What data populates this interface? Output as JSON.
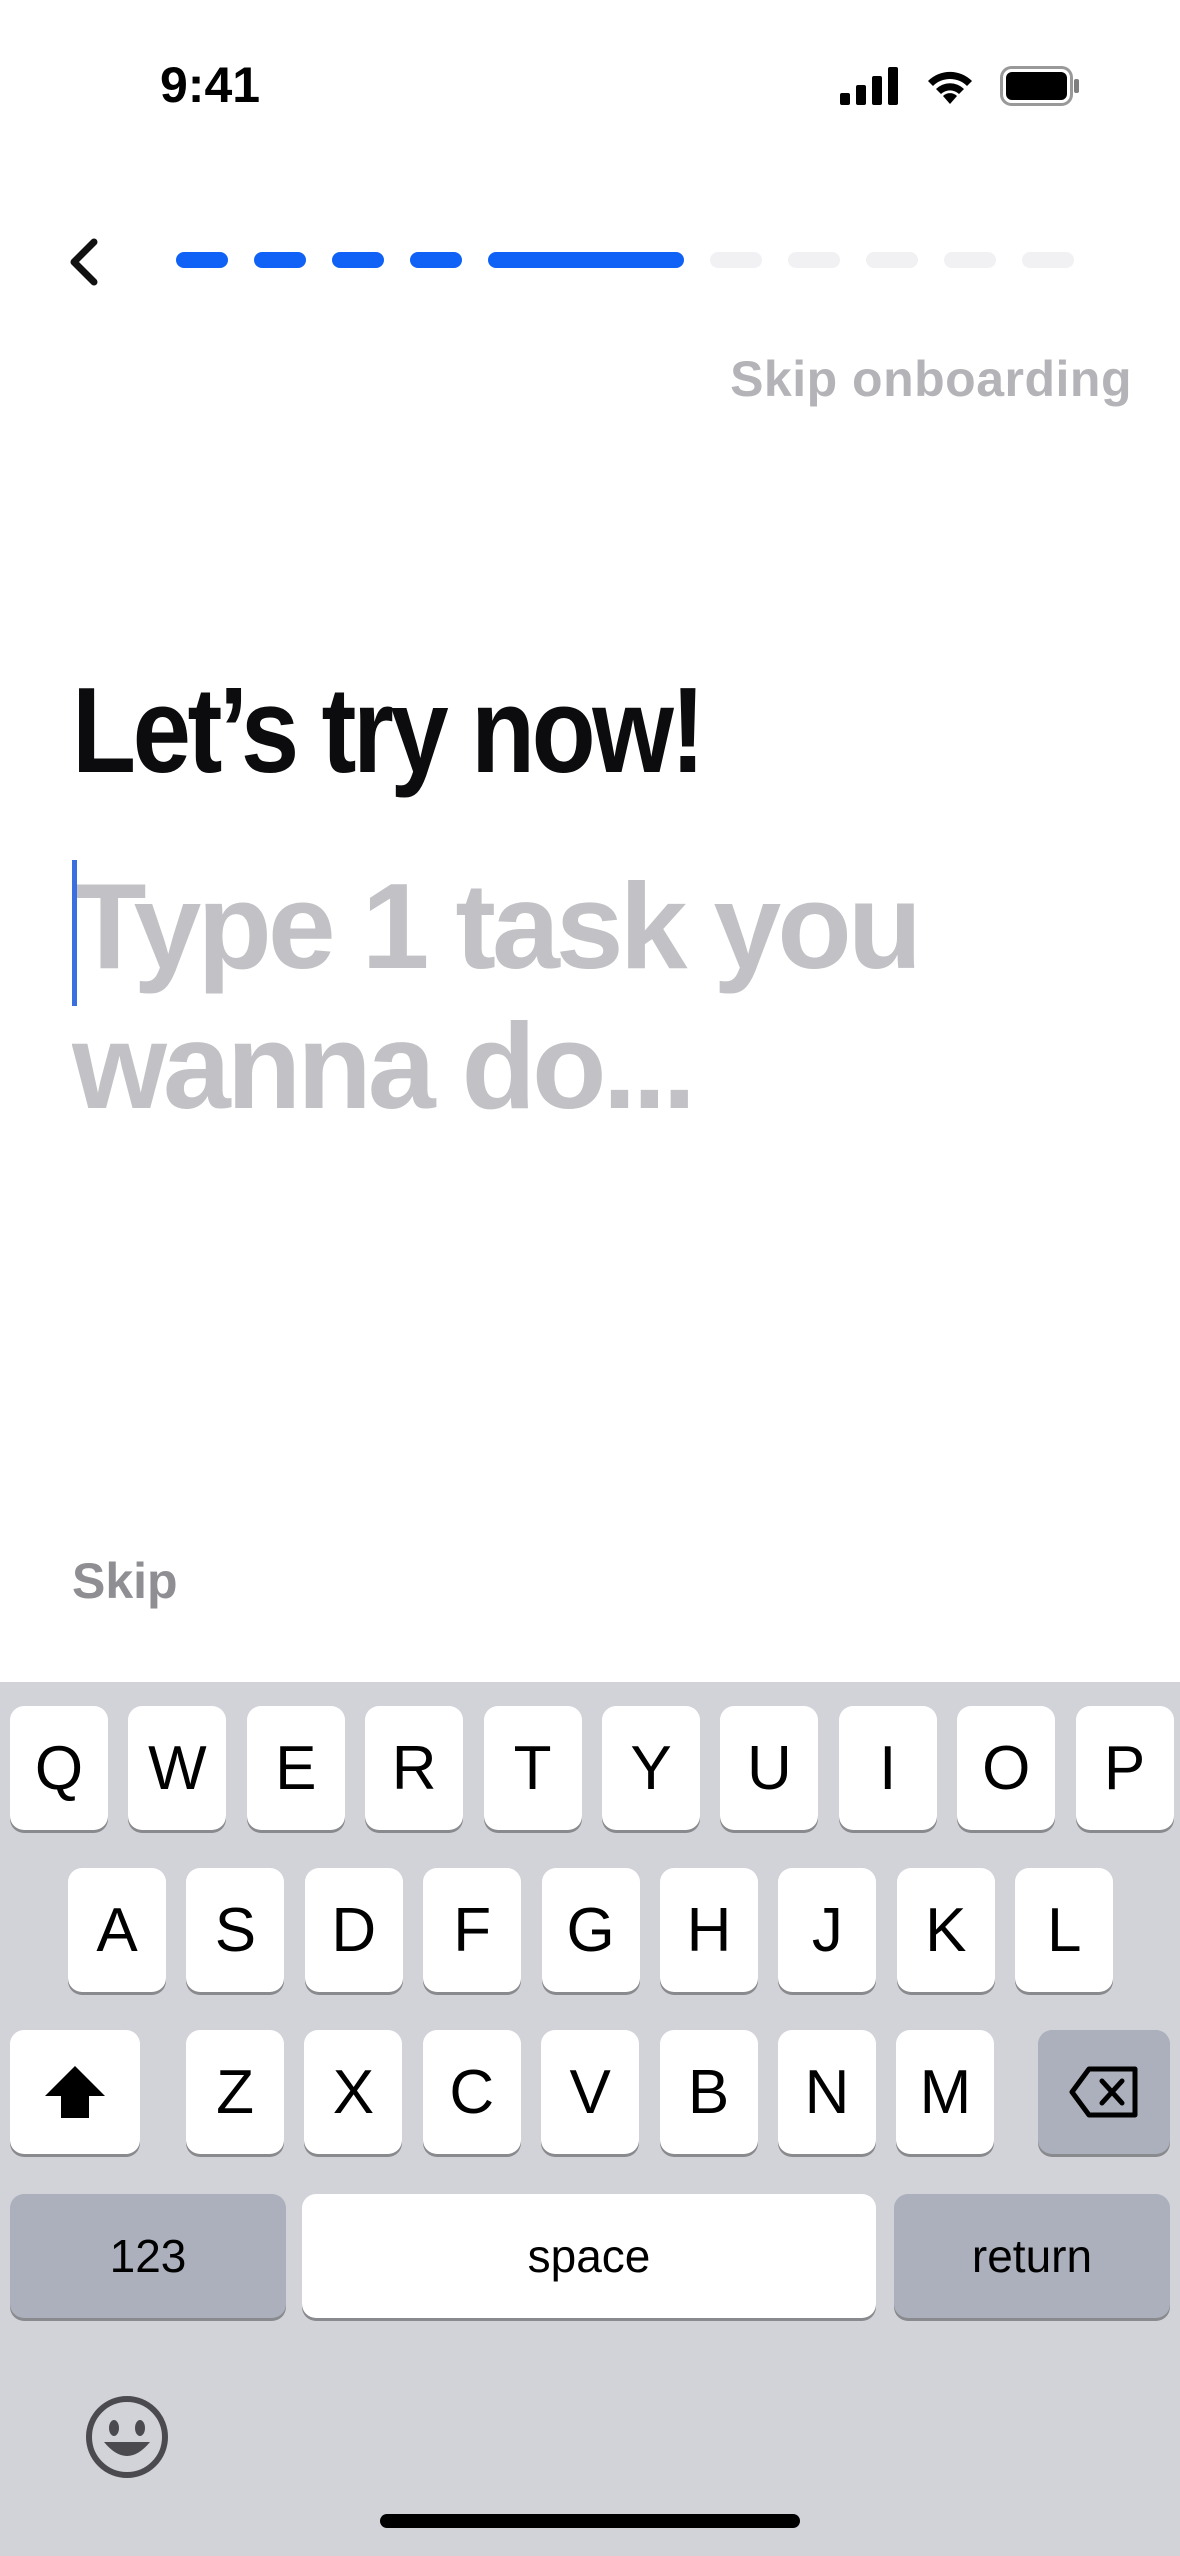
{
  "status_bar": {
    "time": "9:41"
  },
  "header": {
    "back_icon": "chevron-left-icon",
    "progress": {
      "total_steps": 10,
      "current_step": 5,
      "completed_steps": 4
    },
    "skip_onboarding_label": "Skip onboarding"
  },
  "content": {
    "heading": "Let’s try now!",
    "task_input": {
      "value": "",
      "placeholder": "Type 1 task you wanna do..."
    },
    "skip_label": "Skip"
  },
  "keyboard": {
    "row1": [
      "Q",
      "W",
      "E",
      "R",
      "T",
      "Y",
      "U",
      "I",
      "O",
      "P"
    ],
    "row2": [
      "A",
      "S",
      "D",
      "F",
      "G",
      "H",
      "J",
      "K",
      "L"
    ],
    "row3": [
      "Z",
      "X",
      "C",
      "V",
      "B",
      "N",
      "M"
    ],
    "numbers_label": "123",
    "space_label": "space",
    "return_label": "return",
    "shift_icon": "shift-icon",
    "delete_icon": "delete-icon",
    "emoji_icon": "emoji-icon"
  },
  "colors": {
    "accent": "#0f62f5",
    "progress_inactive": "#f1f1f4",
    "heading": "#0c0c0e",
    "placeholder": "#c2c2c6",
    "skip_onboarding": "#b4b4b8",
    "skip": "#8e8e93",
    "keyboard_bg": "#d1d3d9",
    "key_dark": "#abb0bc"
  }
}
